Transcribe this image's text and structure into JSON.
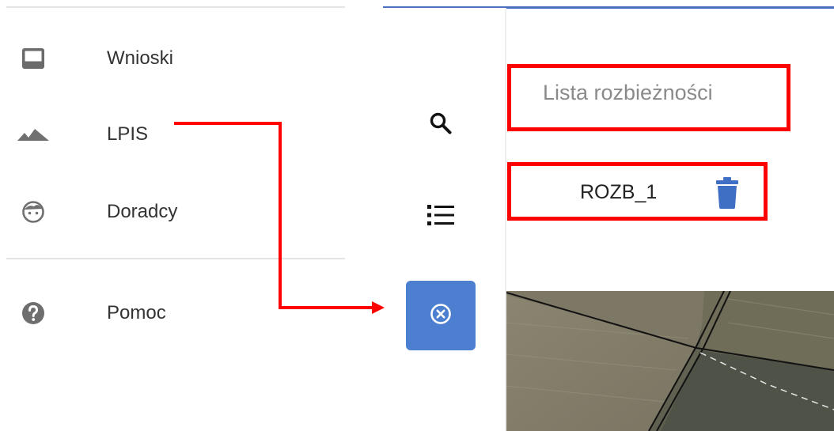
{
  "menu": {
    "items": [
      {
        "label": "Wnioski",
        "icon": "inbox-icon"
      },
      {
        "label": "LPIS",
        "icon": "terrain-icon"
      },
      {
        "label": "Doradcy",
        "icon": "face-icon"
      }
    ],
    "help": {
      "label": "Pomoc",
      "icon": "help-icon"
    }
  },
  "toolbar": {
    "buttons": [
      {
        "icon": "search-icon"
      },
      {
        "icon": "list-icon"
      },
      {
        "icon": "close-circle-icon",
        "active": true
      }
    ]
  },
  "panel": {
    "title": "Lista rozbieżności",
    "items": [
      {
        "name": "ROZB_1",
        "action_icon": "trash-icon"
      }
    ]
  },
  "colors": {
    "accent": "#4d7fd0",
    "annotation": "#ff0000",
    "topbar": "#4a6fc0",
    "trash": "#3f6fc4"
  }
}
